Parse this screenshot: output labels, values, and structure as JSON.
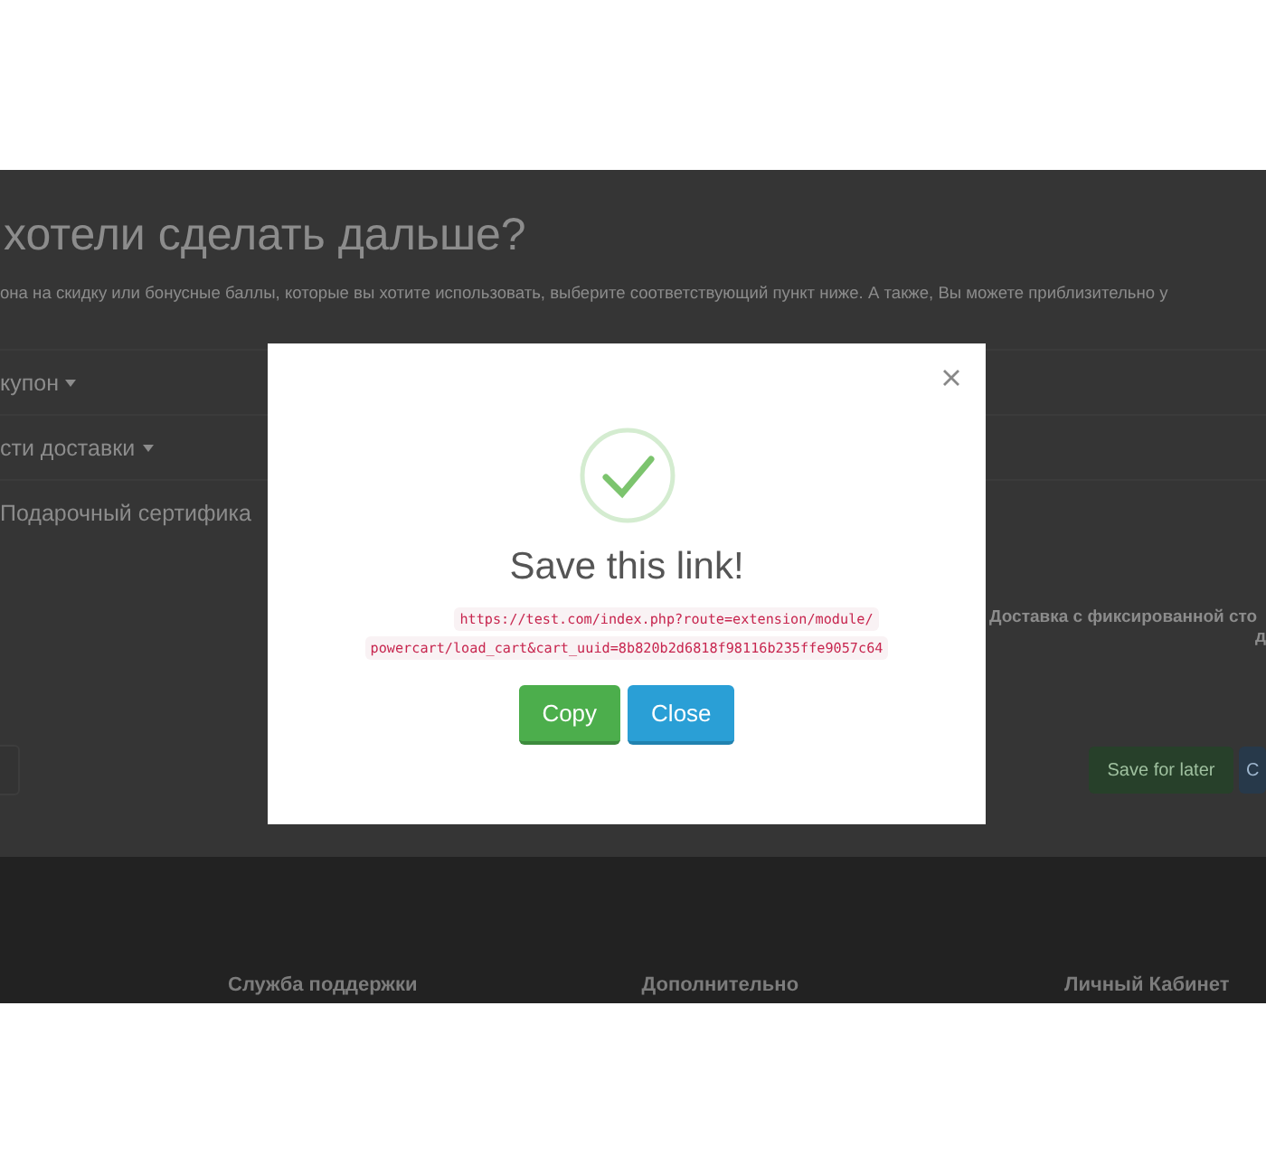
{
  "page": {
    "heading": "хотели сделать дальше?",
    "intro": "она на скидку или бонусные баллы, которые вы хотите использовать, выберите соответствующий пункт ниже. А также, Вы можете приблизительно у",
    "accordion": [
      {
        "label": "купон",
        "kind": "dropdown"
      },
      {
        "label": "сти доставки",
        "kind": "dropdown"
      },
      {
        "label": "Подарочный сертифика",
        "kind": "plain"
      }
    ],
    "shipping_note": [
      "Доставка с фиксированной сто",
      "д"
    ],
    "buttons": [
      {
        "label": "Save for later",
        "kind": "success"
      },
      {
        "label": "C",
        "kind": "primary"
      }
    ],
    "footer": [
      "Служба поддержки",
      "Дополнительно",
      "Личный Кабинет"
    ]
  },
  "modal": {
    "title": "Save this link!",
    "link_lines": [
      "https://test.com/index.php?route=extension/module/",
      "powercart/load_cart&cart_uuid=8b820b2d6818f98116b235ffe9057c64"
    ],
    "buttons": [
      {
        "label": "Copy",
        "kind": "success"
      },
      {
        "label": "Close",
        "kind": "primary"
      }
    ]
  }
}
